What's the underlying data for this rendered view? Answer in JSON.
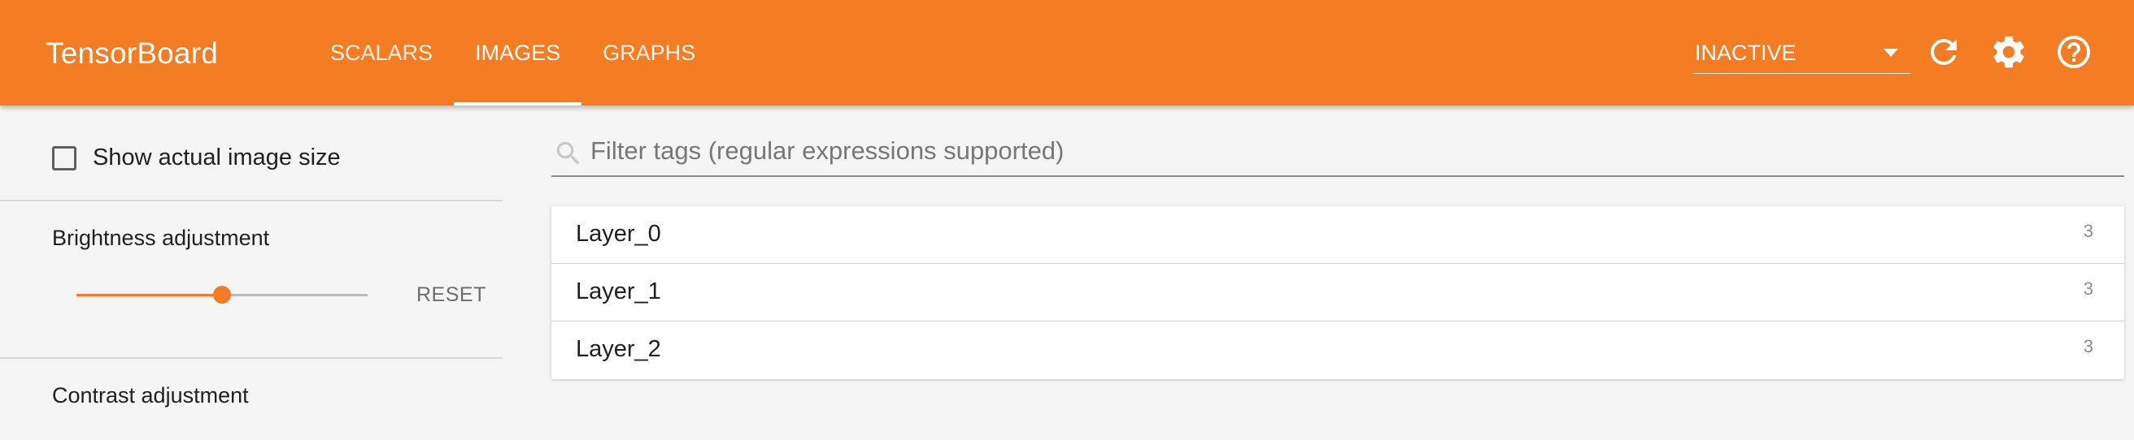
{
  "header": {
    "title": "TensorBoard",
    "tabs": [
      {
        "label": "SCALARS",
        "active": false
      },
      {
        "label": "IMAGES",
        "active": true
      },
      {
        "label": "GRAPHS",
        "active": false
      }
    ],
    "run_select": {
      "value": "INACTIVE",
      "icon": "arrow-drop-down-icon"
    },
    "icons": [
      "refresh-icon",
      "settings-gear-icon",
      "help-circle-icon"
    ],
    "accent_color": "#f47c22"
  },
  "sidebar": {
    "show_actual_size_label": "Show actual image size",
    "show_actual_size_checked": false,
    "brightness": {
      "label": "Brightness adjustment",
      "value_fraction": 0.5,
      "reset_label": "RESET"
    },
    "contrast": {
      "label": "Contrast adjustment"
    }
  },
  "main": {
    "filter": {
      "placeholder": "Filter tags (regular expressions supported)",
      "value": "",
      "icon": "search-icon"
    },
    "tags": [
      {
        "name": "Layer_0",
        "count": "3"
      },
      {
        "name": "Layer_1",
        "count": "3"
      },
      {
        "name": "Layer_2",
        "count": "3"
      }
    ]
  }
}
